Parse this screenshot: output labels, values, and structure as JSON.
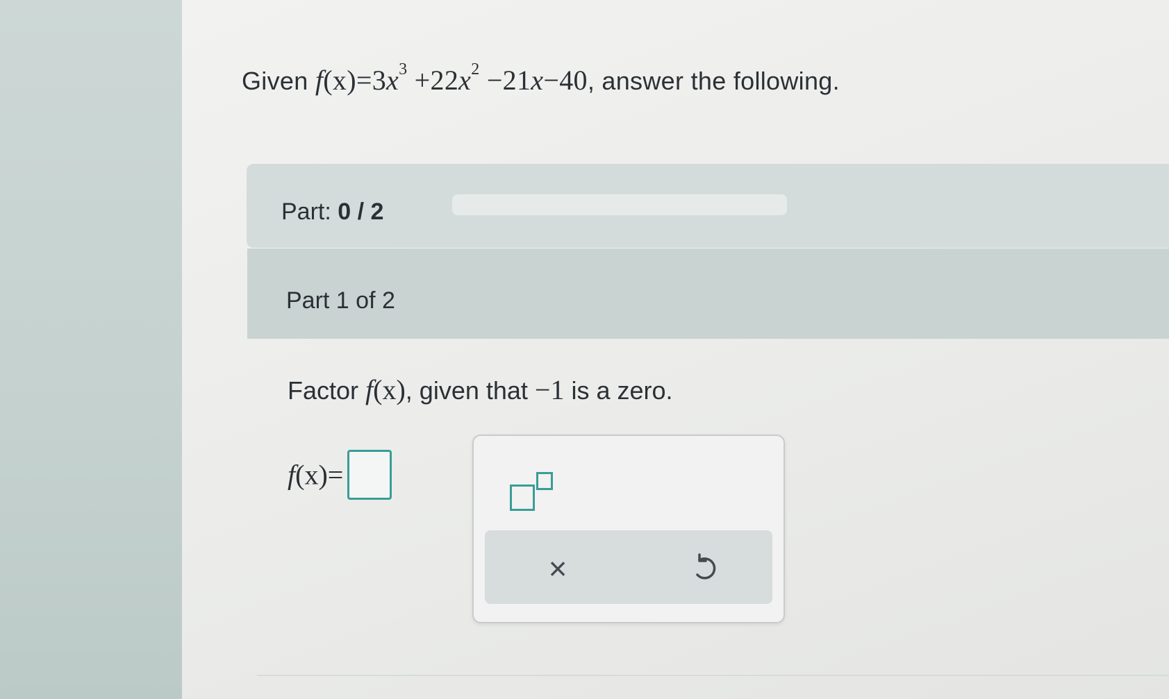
{
  "question": {
    "prefix": "Given ",
    "fn_name": "f",
    "fn_arg": "(x)",
    "equals": "=",
    "term1_coef": "3",
    "term1_var": "x",
    "term1_exp": "3",
    "term2": " +22",
    "term2_var": "x",
    "term2_exp": "2",
    "term3": " −21",
    "term3_var": "x",
    "term4": "−40",
    "suffix": ", answer the following."
  },
  "progress": {
    "label": "Part:",
    "current": "0",
    "separator": " / ",
    "total": "2",
    "fraction": 0
  },
  "subpart": {
    "label": "Part 1 of 2"
  },
  "instruction": {
    "prefix": "Factor ",
    "fn_name": "f",
    "fn_arg": "(x)",
    "middle": ", given that ",
    "zero_value": "−1",
    "suffix": " is a zero."
  },
  "answer": {
    "fn_name": "f",
    "fn_arg": "(x)",
    "equals": "="
  },
  "tools": {
    "superscript_icon": "superscript-template-icon",
    "clear_symbol": "×",
    "clear_icon": "close-icon",
    "undo_icon": "undo-icon"
  },
  "colors": {
    "accent": "#3a9c97",
    "progress_fill": "#3c8dbc"
  }
}
